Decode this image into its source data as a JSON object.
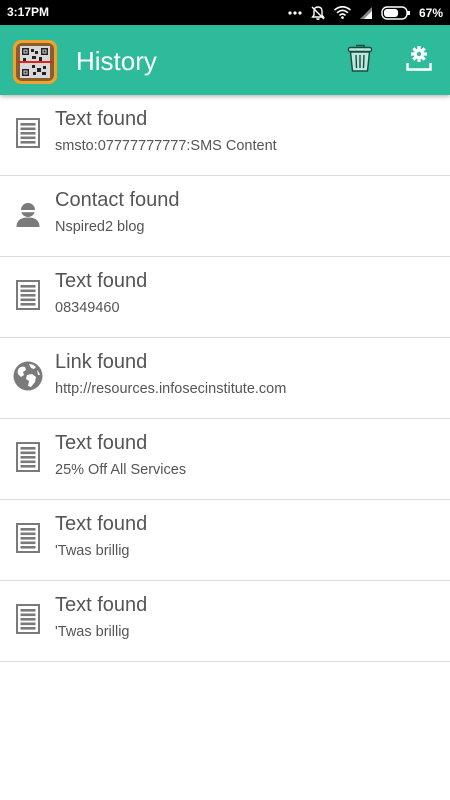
{
  "status_bar": {
    "time": "3:17PM",
    "battery_percent": "67%",
    "battery_level": 0.67
  },
  "app_bar": {
    "title": "History",
    "background_color": "#2ebb9b",
    "actions": [
      {
        "name": "delete",
        "icon": "trash-icon"
      },
      {
        "name": "settings",
        "icon": "gear-upload-icon"
      }
    ]
  },
  "history": {
    "items": [
      {
        "type": "text",
        "icon": "document-icon",
        "title": "Text found",
        "subtitle": "smsto:07777777777:SMS Content"
      },
      {
        "type": "contact",
        "icon": "person-icon",
        "title": "Contact found",
        "subtitle": "Nspired2 blog"
      },
      {
        "type": "text",
        "icon": "document-icon",
        "title": "Text found",
        "subtitle": "08349460"
      },
      {
        "type": "link",
        "icon": "globe-icon",
        "title": "Link found",
        "subtitle": "http://resources.infosecinstitute.com"
      },
      {
        "type": "text",
        "icon": "document-icon",
        "title": "Text found",
        "subtitle": "25% Off All Services"
      },
      {
        "type": "text",
        "icon": "document-icon",
        "title": "Text found",
        "subtitle": "'Twas brillig"
      },
      {
        "type": "text",
        "icon": "document-icon",
        "title": "Text found",
        "subtitle": "'Twas brillig"
      }
    ]
  }
}
